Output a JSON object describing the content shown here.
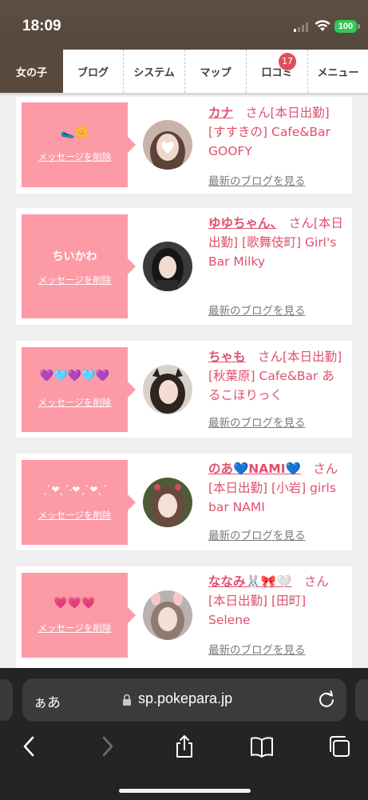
{
  "status_bar": {
    "time": "18:09",
    "battery": "100"
  },
  "nav": {
    "tabs": [
      {
        "label": "女の子",
        "active": true
      },
      {
        "label": "ブログ"
      },
      {
        "label": "システム"
      },
      {
        "label": "マップ"
      },
      {
        "label": "口コミ",
        "badge": "17"
      },
      {
        "label": "メニュー"
      }
    ]
  },
  "cards": [
    {
      "message": "🥿🌼",
      "delete_label": "メッセージを削除",
      "name": "カナ",
      "san": "さん",
      "detail": "[本日出勤] [すすきの] Cafe&Bar GOOFY",
      "blog_link": "最新のブログを見る"
    },
    {
      "message": "ちいかわ",
      "delete_label": "メッセージを削除",
      "name": "ゆゆちゃん、",
      "san": "さん",
      "detail": "[本日出勤] [歌舞伎町] Girl's Bar Milky",
      "blog_link": "最新のブログを見る"
    },
    {
      "message": "💜🩵💜🩵💜",
      "delete_label": "メッセージを削除",
      "name": "ちゃも",
      "san": "さん",
      "detail": "[本日出勤] [秋葉原] Cafe&Bar あるこほりっく",
      "blog_link": "最新のブログを見る"
    },
    {
      "message": "ˏˋ❤︎ˎˊ˗❤︎ˏˋ❤︎ˎˊ",
      "delete_label": "メッセージを削除",
      "name": "のあ💙NAMI💙",
      "san": "さん",
      "detail": "[本日出勤] [小岩] girls bar NAMI",
      "blog_link": "最新のブログを見る"
    },
    {
      "message": "💗💗💗",
      "delete_label": "メッセージを削除",
      "name": "ななみ🐰🎀🤍",
      "san": "さん",
      "detail": "[本日出勤] [田町] Selene",
      "blog_link": "最新のブログを見る"
    }
  ],
  "browser": {
    "aa_label": "ぁあ",
    "url": "sp.pokepara.jp"
  },
  "colors": {
    "accent_pink": "#e0506e",
    "message_pink": "#fc9aa6",
    "nav_active": "#5a4a3d",
    "badge": "#e0505b"
  }
}
